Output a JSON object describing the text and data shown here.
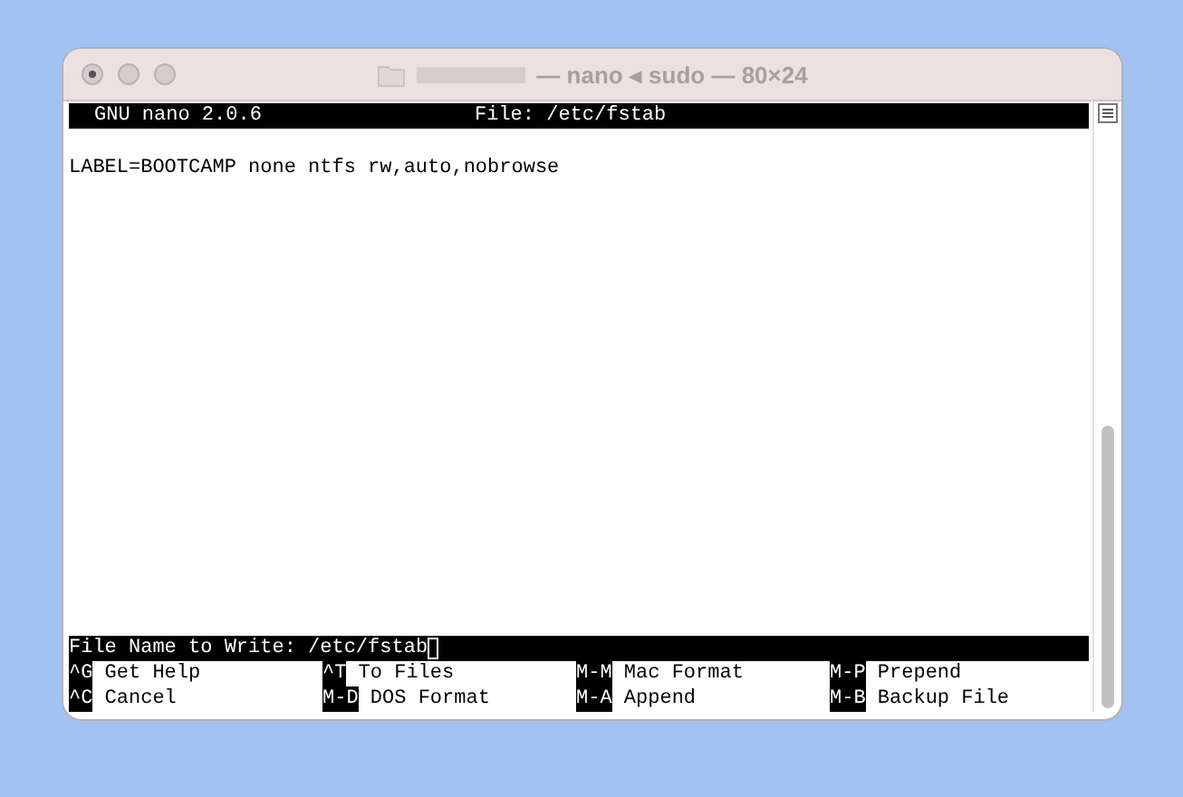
{
  "window": {
    "title": "— nano ◂ sudo — 80×24"
  },
  "header": {
    "version": "GNU nano 2.0.6",
    "file": "File: /etc/fstab"
  },
  "lines": [
    "LABEL=BOOTCAMP none ntfs rw,auto,nobrowse"
  ],
  "prompt": {
    "label": "File Name to Write: ",
    "value": "/etc/fstab"
  },
  "shortcuts": [
    [
      {
        "key": "^G",
        "label": "Get Help"
      },
      {
        "key": "^T",
        "label": "To Files"
      },
      {
        "key": "M-M",
        "label": "Mac Format"
      },
      {
        "key": "M-P",
        "label": "Prepend"
      }
    ],
    [
      {
        "key": "^C",
        "label": "Cancel"
      },
      {
        "key": "M-D",
        "label": "DOS Format"
      },
      {
        "key": "M-A",
        "label": "Append"
      },
      {
        "key": "M-B",
        "label": "Backup File"
      }
    ]
  ]
}
